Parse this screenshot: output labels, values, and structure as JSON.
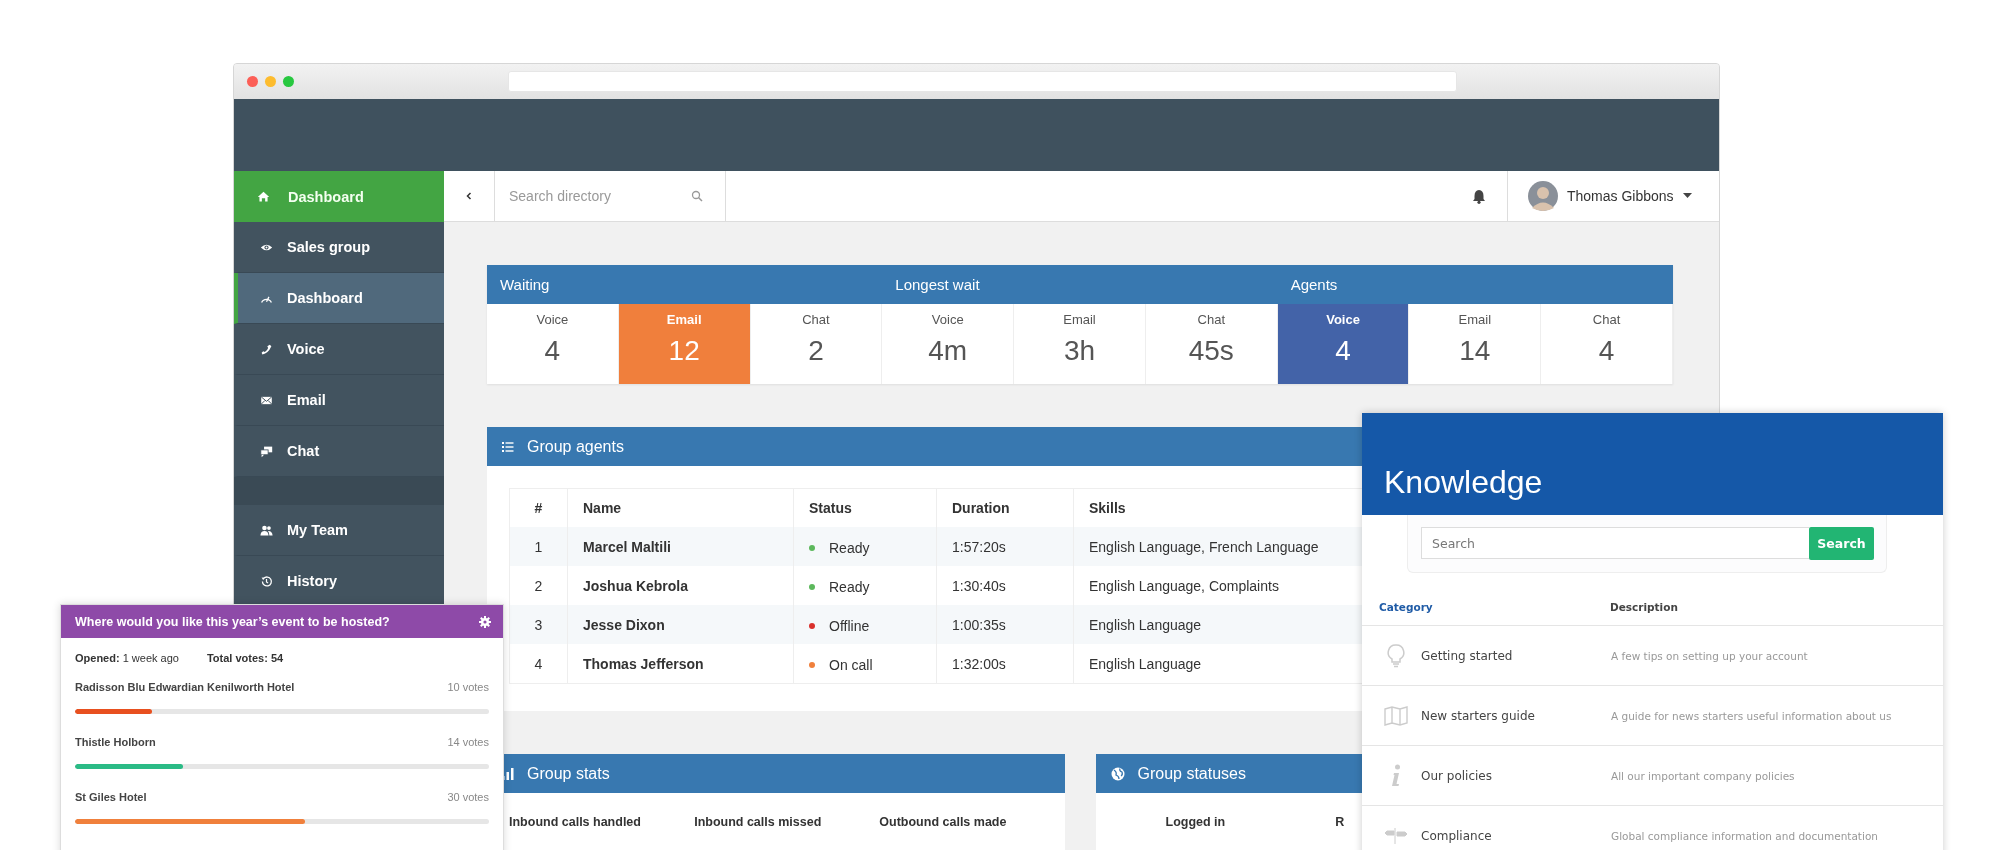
{
  "sidebar": {
    "home": {
      "label": "Dashboard"
    },
    "groups": [
      {
        "items": [
          {
            "label": "Sales group",
            "selected": false
          },
          {
            "label": "Dashboard",
            "selected": true
          },
          {
            "label": "Voice",
            "selected": false
          },
          {
            "label": "Email",
            "selected": false
          },
          {
            "label": "Chat",
            "selected": false
          }
        ]
      },
      {
        "items": [
          {
            "label": "My Team",
            "selected": false
          },
          {
            "label": "History",
            "selected": false
          }
        ]
      }
    ]
  },
  "topbar": {
    "search": {
      "placeholder": "Search directory"
    },
    "user": {
      "name": "Thomas Gibbons"
    }
  },
  "stats": [
    {
      "title": "Waiting",
      "cells": [
        {
          "label": "Voice",
          "value": "4"
        },
        {
          "label": "Email",
          "value": "12",
          "color": "#f07f3c"
        },
        {
          "label": "Chat",
          "value": "2"
        }
      ]
    },
    {
      "title": "Longest wait",
      "cells": [
        {
          "label": "Voice",
          "value": "4m"
        },
        {
          "label": "Email",
          "value": "3h"
        },
        {
          "label": "Chat",
          "value": "45s"
        }
      ]
    },
    {
      "title": "Agents",
      "cells": [
        {
          "label": "Voice",
          "value": "4",
          "color": "#4363a8"
        },
        {
          "label": "Email",
          "value": "14"
        },
        {
          "label": "Chat",
          "value": "4"
        }
      ]
    }
  ],
  "group_agents": {
    "title": "Group agents",
    "columns": [
      "#",
      "Name",
      "Status",
      "Duration",
      "Skills"
    ],
    "rows": [
      {
        "index": "1",
        "name": "Marcel Maltili",
        "status": "Ready",
        "color": "#5cb85c",
        "duration": "1:57:20s",
        "skills": "English Language, French Language"
      },
      {
        "index": "2",
        "name": "Joshua Kebrola",
        "status": "Ready",
        "color": "#5cb85c",
        "duration": "1:30:40s",
        "skills": "English Language, Complaints"
      },
      {
        "index": "3",
        "name": "Jesse Dixon",
        "status": "Offline",
        "color": "#d9302c",
        "duration": "1:00:35s",
        "skills": "English Language"
      },
      {
        "index": "4",
        "name": "Thomas Jefferson",
        "status": "On call",
        "color": "#f0803c",
        "duration": "1:32:00s",
        "skills": "English Language"
      }
    ]
  },
  "group_stats": {
    "title": "Group stats",
    "columns": [
      "Inbound calls handled",
      "Inbound calls missed",
      "Outbound calls made"
    ]
  },
  "group_statuses": {
    "title": "Group statuses",
    "columns": [
      "Logged in",
      "R"
    ]
  },
  "poll": {
    "question": "Where would you like this year’s event to be hosted?",
    "opened_label": "Opened:",
    "opened": "1 week ago",
    "total": "Total votes: 54",
    "options": [
      {
        "name": "Radisson Blu Edwardian Kenilworth Hotel",
        "votes": "10 votes",
        "level": 0.185,
        "color": "#e8501f"
      },
      {
        "name": "Thistle Holborn",
        "votes": "14 votes",
        "level": 0.26,
        "color": "#2bbb86"
      },
      {
        "name": "St Giles Hotel",
        "votes": "30 votes",
        "level": 0.555,
        "color": "#f0803c"
      }
    ]
  },
  "knowledge": {
    "title": "Knowledge",
    "search": {
      "placeholder": "Search",
      "button": "Search"
    },
    "columns": [
      "Category",
      "Description"
    ],
    "rows": [
      {
        "category": "Getting started",
        "description": "A few tips on setting up your account"
      },
      {
        "category": "New starters guide",
        "description": "A guide for news starters useful information about us"
      },
      {
        "category": "Our policies",
        "description": "All our important company policies"
      },
      {
        "category": "Compliance",
        "description": "Global compliance information and documentation"
      }
    ]
  }
}
